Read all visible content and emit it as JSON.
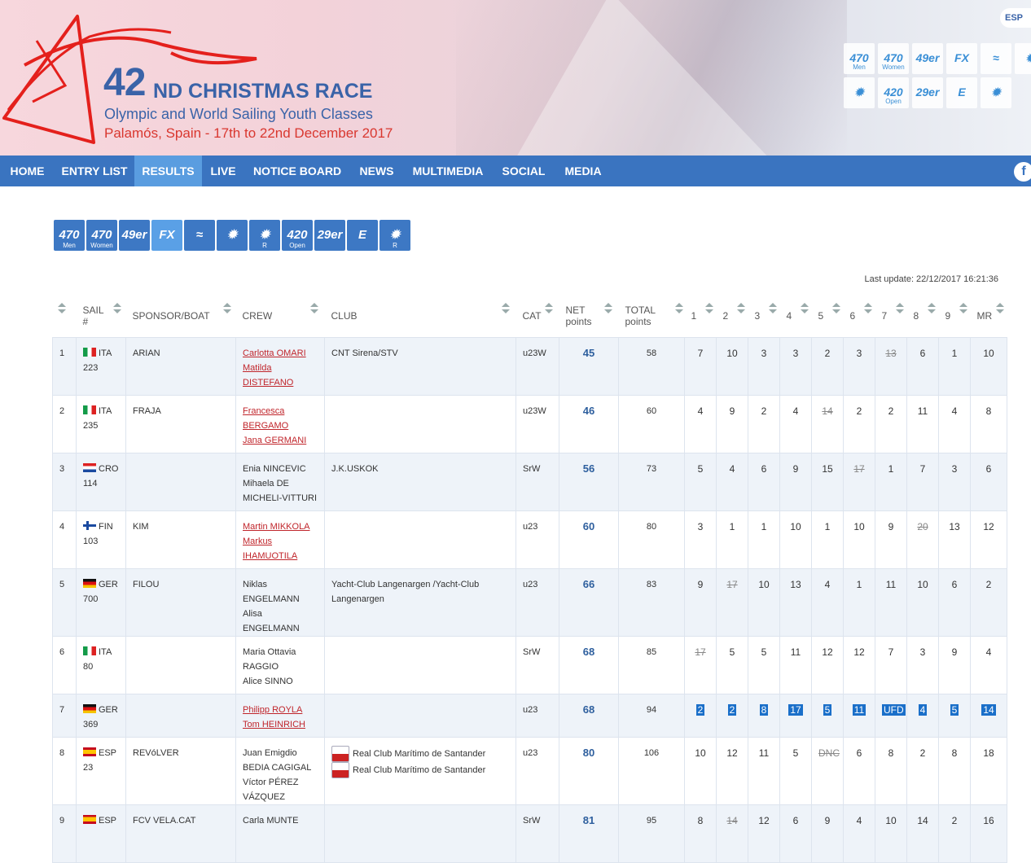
{
  "header": {
    "title_num": "42",
    "title_rest": "ND CHRISTMAS RACE",
    "subtitle": "Olympic and World Sailing Youth Classes",
    "place": "Palamós, Spain - 17th to 22nd December 2017",
    "lang": "ESP",
    "icons_row1": [
      "470 Men",
      "470 Women",
      "49er",
      "FX",
      "≈",
      "✹"
    ],
    "icons_row2": [
      "✹ R",
      "420 Open",
      "29er",
      "E",
      "✹ R"
    ]
  },
  "nav": {
    "items": [
      "HOME",
      "ENTRY LIST",
      "RESULTS",
      "LIVE",
      "NOTICE BOARD",
      "NEWS",
      "MULTIMEDIA",
      "SOCIAL",
      "MEDIA"
    ],
    "active": "RESULTS",
    "facebook": "f"
  },
  "classes": [
    {
      "label": "470",
      "sub": "Men"
    },
    {
      "label": "470",
      "sub": "Women"
    },
    {
      "label": "49er",
      "sub": ""
    },
    {
      "label": "FX",
      "sub": ""
    },
    {
      "label": "≈",
      "sub": ""
    },
    {
      "label": "✹",
      "sub": ""
    },
    {
      "label": "✹",
      "sub": "R"
    },
    {
      "label": "420",
      "sub": "Open"
    },
    {
      "label": "29er",
      "sub": ""
    },
    {
      "label": "E",
      "sub": ""
    },
    {
      "label": "✹",
      "sub": "R"
    }
  ],
  "last_update": "Last update: 22/12/2017 16:21:36",
  "table": {
    "headers": {
      "sail": "SAIL",
      "sail2": "#",
      "sponsor": "SPONSOR/BOAT",
      "crew": "CREW",
      "club": "CLUB",
      "cat": "CAT",
      "net": "NET",
      "net2": "points",
      "total": "TOTAL",
      "total2": "points",
      "races": [
        "1",
        "2",
        "3",
        "4",
        "5",
        "6",
        "7",
        "8",
        "9",
        "MR"
      ]
    },
    "rows": [
      {
        "pos": "1",
        "country": "ITA",
        "sail": "223",
        "sponsor": "ARIAN",
        "crew": [
          "Carlotta OMARI",
          "Matilda DISTEFANO"
        ],
        "crew_link": true,
        "club": [
          "CNT Sirena/STV"
        ],
        "cat": "u23W",
        "net": "45",
        "total": "58",
        "races": [
          "7",
          "10",
          "3",
          "3",
          "2",
          "3",
          "13",
          "6",
          "1",
          "10"
        ],
        "discard": [
          6
        ]
      },
      {
        "pos": "2",
        "country": "ITA",
        "sail": "235",
        "sponsor": "FRAJA",
        "crew": [
          "Francesca BERGAMO",
          "Jana GERMANI"
        ],
        "crew_link": true,
        "club": [],
        "cat": "u23W",
        "net": "46",
        "total": "60",
        "races": [
          "4",
          "9",
          "2",
          "4",
          "14",
          "2",
          "2",
          "11",
          "4",
          "8"
        ],
        "discard": [
          4
        ]
      },
      {
        "pos": "3",
        "country": "CRO",
        "sail": "114",
        "sponsor": "",
        "crew": [
          "Enia NINCEVIC",
          "Mihaela DE MICHELI-VITTURI"
        ],
        "crew_link": false,
        "club": [
          "J.K.USKOK"
        ],
        "cat": "SrW",
        "net": "56",
        "total": "73",
        "races": [
          "5",
          "4",
          "6",
          "9",
          "15",
          "17",
          "1",
          "7",
          "3",
          "6"
        ],
        "discard": [
          5
        ]
      },
      {
        "pos": "4",
        "country": "FIN",
        "sail": "103",
        "sponsor": "KIM",
        "crew": [
          "Martin MIKKOLA",
          "Markus IHAMUOTILA"
        ],
        "crew_link": true,
        "club": [],
        "cat": "u23",
        "net": "60",
        "total": "80",
        "races": [
          "3",
          "1",
          "1",
          "10",
          "1",
          "10",
          "9",
          "20",
          "13",
          "12"
        ],
        "discard": [
          7
        ]
      },
      {
        "pos": "5",
        "country": "GER",
        "sail": "700",
        "sponsor": "FILOU",
        "crew": [
          "Niklas ENGELMANN",
          "Alisa ENGELMANN"
        ],
        "crew_link": false,
        "club": [
          "Yacht-Club Langenargen /Yacht-Club Langenargen"
        ],
        "cat": "u23",
        "net": "66",
        "total": "83",
        "races": [
          "9",
          "17",
          "10",
          "13",
          "4",
          "1",
          "11",
          "10",
          "6",
          "2"
        ],
        "discard": [
          1
        ]
      },
      {
        "pos": "6",
        "country": "ITA",
        "sail": "80",
        "sponsor": "",
        "crew": [
          "Maria Ottavia RAGGIO",
          "Alice SINNO"
        ],
        "crew_link": false,
        "club": [],
        "cat": "SrW",
        "net": "68",
        "total": "85",
        "races": [
          "17",
          "5",
          "5",
          "11",
          "12",
          "12",
          "7",
          "3",
          "9",
          "4"
        ],
        "discard": [
          0
        ]
      },
      {
        "pos": "7",
        "country": "GER",
        "sail": "369",
        "sponsor": "",
        "crew": [
          "Philipp ROYLA",
          "Tom HEINRICH"
        ],
        "crew_link": true,
        "club": [],
        "cat": "u23",
        "net": "68",
        "total": "94",
        "races": [
          "2",
          "2",
          "8",
          "17",
          "5",
          "11",
          "UFD",
          "4",
          "5",
          "14"
        ],
        "discard": [
          6
        ],
        "selected": true
      },
      {
        "pos": "8",
        "country": "ESP",
        "sail": "23",
        "sponsor": "REVóLVER",
        "crew": [
          "Juan Emigdio BEDIA CAGIGAL",
          "Víctor PÉREZ VÁZQUEZ"
        ],
        "crew_link": false,
        "club": [
          "Real Club Marítimo de Santander",
          "Real Club Marítimo de Santander"
        ],
        "cat": "u23",
        "net": "80",
        "total": "106",
        "races": [
          "10",
          "12",
          "11",
          "5",
          "DNC",
          "6",
          "8",
          "2",
          "8",
          "18"
        ],
        "discard": [
          4
        ]
      },
      {
        "pos": "9",
        "country": "ESP",
        "sail": "",
        "sponsor": "FCV VELA.CAT",
        "crew": [
          "Carla MUNTE"
        ],
        "crew_link": false,
        "club": [],
        "cat": "SrW",
        "net": "81",
        "total": "95",
        "races": [
          "8",
          "14",
          "12",
          "6",
          "9",
          "4",
          "10",
          "14",
          "2",
          "16"
        ],
        "discard": [
          1
        ]
      }
    ]
  },
  "colors": {
    "nav_bg": "#3a74c0",
    "nav_active": "#5a9de0",
    "title_blue": "#3a63a8",
    "place_red": "#d9372f",
    "net_blue": "#2e5f9e"
  }
}
